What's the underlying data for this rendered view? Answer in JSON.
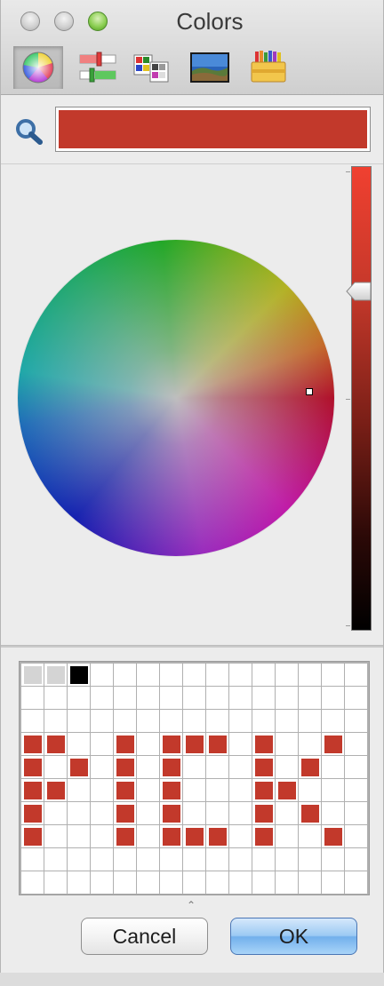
{
  "window": {
    "title": "Colors"
  },
  "toolbar": {
    "tabs": [
      {
        "icon": "color-wheel-icon",
        "selected": true
      },
      {
        "icon": "color-sliders-icon",
        "selected": false
      },
      {
        "icon": "color-palettes-icon",
        "selected": false
      },
      {
        "icon": "image-palettes-icon",
        "selected": false
      },
      {
        "icon": "crayons-icon",
        "selected": false
      }
    ]
  },
  "current_color": "#c2392b",
  "brightness_level": 0.73,
  "swatches": {
    "columns": 15,
    "rows": 10,
    "filled": [
      {
        "row": 0,
        "col": 0,
        "color": "#d4d4d4"
      },
      {
        "row": 0,
        "col": 1,
        "color": "#d4d4d4"
      },
      {
        "row": 0,
        "col": 2,
        "color": "#000000"
      },
      {
        "row": 3,
        "col": 0,
        "color": "#c2392b"
      },
      {
        "row": 3,
        "col": 1,
        "color": "#c2392b"
      },
      {
        "row": 3,
        "col": 4,
        "color": "#c2392b"
      },
      {
        "row": 3,
        "col": 6,
        "color": "#c2392b"
      },
      {
        "row": 3,
        "col": 7,
        "color": "#c2392b"
      },
      {
        "row": 3,
        "col": 8,
        "color": "#c2392b"
      },
      {
        "row": 3,
        "col": 10,
        "color": "#c2392b"
      },
      {
        "row": 3,
        "col": 13,
        "color": "#c2392b"
      },
      {
        "row": 4,
        "col": 0,
        "color": "#c2392b"
      },
      {
        "row": 4,
        "col": 2,
        "color": "#c2392b"
      },
      {
        "row": 4,
        "col": 4,
        "color": "#c2392b"
      },
      {
        "row": 4,
        "col": 6,
        "color": "#c2392b"
      },
      {
        "row": 4,
        "col": 10,
        "color": "#c2392b"
      },
      {
        "row": 4,
        "col": 12,
        "color": "#c2392b"
      },
      {
        "row": 5,
        "col": 0,
        "color": "#c2392b"
      },
      {
        "row": 5,
        "col": 1,
        "color": "#c2392b"
      },
      {
        "row": 5,
        "col": 4,
        "color": "#c2392b"
      },
      {
        "row": 5,
        "col": 6,
        "color": "#c2392b"
      },
      {
        "row": 5,
        "col": 10,
        "color": "#c2392b"
      },
      {
        "row": 5,
        "col": 11,
        "color": "#c2392b"
      },
      {
        "row": 6,
        "col": 0,
        "color": "#c2392b"
      },
      {
        "row": 6,
        "col": 4,
        "color": "#c2392b"
      },
      {
        "row": 6,
        "col": 6,
        "color": "#c2392b"
      },
      {
        "row": 6,
        "col": 10,
        "color": "#c2392b"
      },
      {
        "row": 6,
        "col": 12,
        "color": "#c2392b"
      },
      {
        "row": 7,
        "col": 0,
        "color": "#c2392b"
      },
      {
        "row": 7,
        "col": 4,
        "color": "#c2392b"
      },
      {
        "row": 7,
        "col": 6,
        "color": "#c2392b"
      },
      {
        "row": 7,
        "col": 7,
        "color": "#c2392b"
      },
      {
        "row": 7,
        "col": 8,
        "color": "#c2392b"
      },
      {
        "row": 7,
        "col": 10,
        "color": "#c2392b"
      },
      {
        "row": 7,
        "col": 13,
        "color": "#c2392b"
      }
    ]
  },
  "buttons": {
    "cancel": "Cancel",
    "ok": "OK"
  }
}
